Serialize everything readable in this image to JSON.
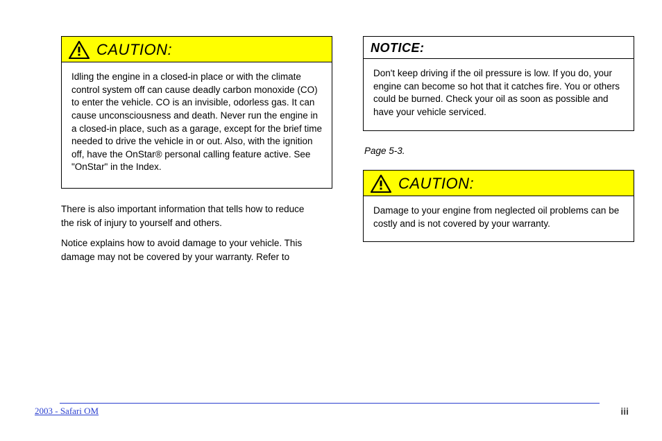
{
  "left_caution": {
    "header": "CAUTION:",
    "body_html": "Idling the engine in a closed-in place or with the climate control system off can cause deadly carbon monoxide (CO) to enter the vehicle. CO is an invisible, odorless gas. It can cause unconsciousness and death. Never run the engine in a closed-in place, such as a garage, except for the brief time needed to drive the vehicle in or out. Also, with the ignition off, have the OnStar® personal calling feature active. See \"OnStar\" in the Index."
  },
  "notice": {
    "header": "NOTICE:",
    "body": "Don't keep driving if the oil pressure is low. If you do, your engine can become so hot that it catches fire. You or others could be burned. Check your oil as soon as possible and have your vehicle serviced."
  },
  "right_caution": {
    "header": "CAUTION:",
    "body": "Damage to your engine from neglected oil problems can be costly and is not covered by your warranty."
  },
  "page_ref": "Page 5-3.",
  "prose": {
    "p1": "There is also important information that tells how to reduce the risk of injury to yourself and others.",
    "p2_prefix": "Notice explains how to avoid damage to your vehicle. This damage may not be covered by your warranty. Refer to ",
    "p2_link_text": ""
  },
  "footer": {
    "link": "2003 - Safari OM",
    "page": "iii"
  }
}
